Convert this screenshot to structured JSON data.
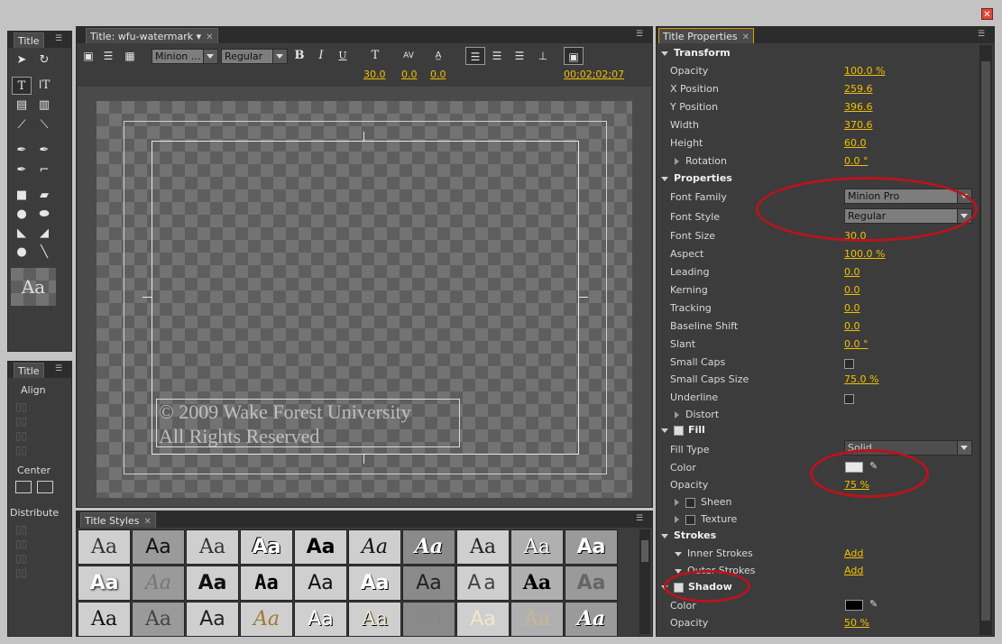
{
  "left_top_panel": {
    "tab": "Title"
  },
  "left_bottom_panel": {
    "tab": "Title",
    "align_label": "Align",
    "center_label": "Center",
    "distribute_label": "Distribute"
  },
  "main_panel": {
    "tab": "Title: wfu-watermark",
    "font_family": "Minion ...",
    "font_style": "Regular",
    "bold": "B",
    "italic": "I",
    "underline": "U",
    "font_size": "30.0",
    "kerning": "0.0",
    "leading": "0.0",
    "timecode": "00;02;02;07",
    "watermark_line1": "© 2009 Wake Forest University",
    "watermark_line2": "All Rights Reserved"
  },
  "styles_panel": {
    "tab": "Title Styles",
    "sample": "Aa"
  },
  "props": {
    "tab": "Title Properties",
    "transform_header": "Transform",
    "opacity_label": "Opacity",
    "opacity_value": "100.0 %",
    "xpos_label": "X Position",
    "xpos_value": "259.6",
    "ypos_label": "Y Position",
    "ypos_value": "396.6",
    "width_label": "Width",
    "width_value": "370.6",
    "height_label": "Height",
    "height_value": "60.0",
    "rotation_label": "Rotation",
    "rotation_value": "0.0 °",
    "properties_header": "Properties",
    "font_family_label": "Font Family",
    "font_family_value": "Minion Pro",
    "font_style_label": "Font Style",
    "font_style_value": "Regular",
    "font_size_label": "Font Size",
    "font_size_value": "30.0",
    "aspect_label": "Aspect",
    "aspect_value": "100.0 %",
    "leading_label": "Leading",
    "leading_value": "0.0",
    "kerning_label": "Kerning",
    "kerning_value": "0.0",
    "tracking_label": "Tracking",
    "tracking_value": "0.0",
    "baseline_label": "Baseline Shift",
    "baseline_value": "0.0",
    "slant_label": "Slant",
    "slant_value": "0.0 °",
    "smallcaps_label": "Small Caps",
    "smallcaps_size_label": "Small Caps Size",
    "smallcaps_size_value": "75.0 %",
    "underline_label": "Underline",
    "distort_label": "Distort",
    "fill_header": "Fill",
    "fill_type_label": "Fill Type",
    "fill_type_value": "Solid",
    "color_label": "Color",
    "fill_opacity_label": "Opacity",
    "fill_opacity_value": "75 %",
    "sheen_label": "Sheen",
    "texture_label": "Texture",
    "strokes_header": "Strokes",
    "inner_label": "Inner Strokes",
    "inner_add": "Add",
    "outer_label": "Outer Strokes",
    "outer_add": "Add",
    "shadow_header": "Shadow",
    "shadow_color_label": "Color",
    "shadow_opacity_label": "Opacity",
    "shadow_opacity_value": "50 %"
  },
  "colors": {
    "accent": "#f0c000",
    "annotation": "#b8141c"
  }
}
